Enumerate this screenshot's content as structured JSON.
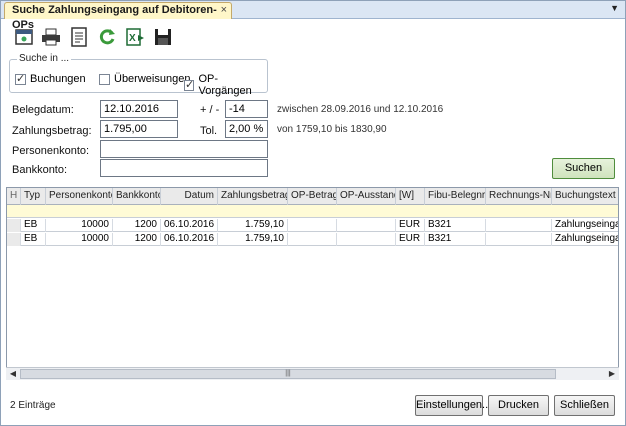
{
  "tab": {
    "title": "Suche Zahlungseingang auf Debitoren-OPs",
    "close": "×"
  },
  "toolbar": {
    "icons": [
      "new-window-icon",
      "print-icon",
      "document-list-icon",
      "refresh-icon",
      "excel-export-icon",
      "save-icon"
    ]
  },
  "search_in": {
    "legend": "Suche in ...",
    "options": [
      {
        "label": "Buchungen",
        "checked": true
      },
      {
        "label": "Überweisungen",
        "checked": false
      },
      {
        "label": "OP-Vorgängen",
        "checked": true
      }
    ]
  },
  "form": {
    "belegdatum_label": "Belegdatum:",
    "belegdatum_value": "12.10.2016",
    "plusminus_label": "+ / -",
    "plusminus_value": "-14",
    "date_range_note": "zwischen 28.09.2016 und 12.10.2016",
    "betrag_label": "Zahlungsbetrag:",
    "betrag_value": "1.795,00",
    "tol_label": "Tol.",
    "tol_value": "2,00 %",
    "amount_range_note": "von 1759,10 bis 1830,90",
    "personenkonto_label": "Personenkonto:",
    "personenkonto_value": "",
    "bankkonto_label": "Bankkonto:",
    "bankkonto_value": ""
  },
  "buttons": {
    "suchen": "Suchen",
    "einstellungen": "Einstellungen...",
    "drucken": "Drucken",
    "schliessen": "Schließen"
  },
  "table": {
    "corner": "H",
    "columns": [
      "Typ",
      "Personenkonto",
      "Bankkonto",
      "Datum",
      "Zahlungsbetrag",
      "OP-Betrag",
      "OP-Ausstand",
      "[W]",
      "Fibu-Belegnr.",
      "Rechnungs-Nr.",
      "Buchungstext"
    ],
    "rows": [
      [
        "EB",
        "10000",
        "1200",
        "06.10.2016",
        "1.759,10",
        "",
        "",
        "EUR",
        "B321",
        "",
        "Zahlungseingang"
      ],
      [
        "EB",
        "10000",
        "1200",
        "06.10.2016",
        "1.759,10",
        "",
        "",
        "EUR",
        "B321",
        "",
        "Zahlungseingang"
      ]
    ]
  },
  "scrollbar": {
    "left": "◀",
    "right": "▶",
    "grip": "|||"
  },
  "status": {
    "count": "2 Einträge"
  },
  "colors": {
    "tab_active": "#fff7c9",
    "filter_row": "#fffbd6",
    "suchen_button": "#cfe3bd"
  }
}
